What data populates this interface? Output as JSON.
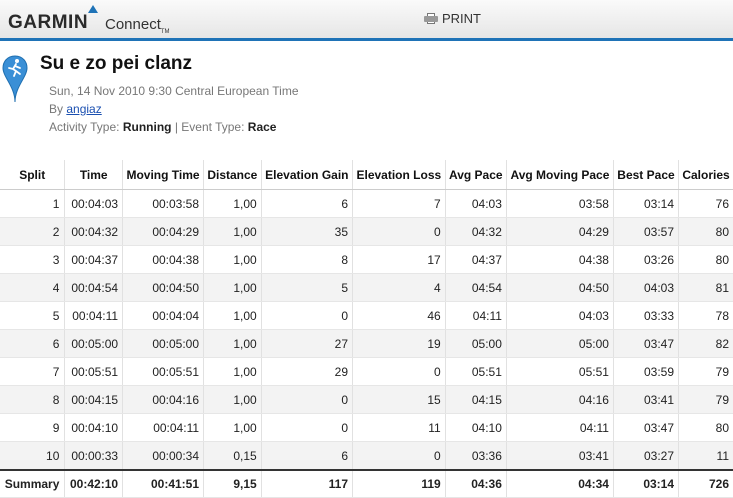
{
  "header": {
    "logo": "GARMIN",
    "logo_sub": "Connect",
    "logo_tm": "TM",
    "print_label": "PRINT"
  },
  "activity": {
    "title": "Su e zo pei clanz",
    "datetime": "Sun, 14 Nov 2010 9:30 Central European Time",
    "by_prefix": "By",
    "author": "angiaz",
    "type_label": "Activity Type:",
    "type_value": "Running",
    "event_label": "| Event Type:",
    "event_value": "Race"
  },
  "table": {
    "columns": [
      "Split",
      "Time",
      "Moving Time",
      "Distance",
      "Elevation Gain",
      "Elevation Loss",
      "Avg Pace",
      "Avg Moving Pace",
      "Best Pace",
      "Calories"
    ],
    "rows": [
      [
        "1",
        "00:04:03",
        "00:03:58",
        "1,00",
        "6",
        "7",
        "04:03",
        "03:58",
        "03:14",
        "76"
      ],
      [
        "2",
        "00:04:32",
        "00:04:29",
        "1,00",
        "35",
        "0",
        "04:32",
        "04:29",
        "03:57",
        "80"
      ],
      [
        "3",
        "00:04:37",
        "00:04:38",
        "1,00",
        "8",
        "17",
        "04:37",
        "04:38",
        "03:26",
        "80"
      ],
      [
        "4",
        "00:04:54",
        "00:04:50",
        "1,00",
        "5",
        "4",
        "04:54",
        "04:50",
        "04:03",
        "81"
      ],
      [
        "5",
        "00:04:11",
        "00:04:04",
        "1,00",
        "0",
        "46",
        "04:11",
        "04:03",
        "03:33",
        "78"
      ],
      [
        "6",
        "00:05:00",
        "00:05:00",
        "1,00",
        "27",
        "19",
        "05:00",
        "05:00",
        "03:47",
        "82"
      ],
      [
        "7",
        "00:05:51",
        "00:05:51",
        "1,00",
        "29",
        "0",
        "05:51",
        "05:51",
        "03:59",
        "79"
      ],
      [
        "8",
        "00:04:15",
        "00:04:16",
        "1,00",
        "0",
        "15",
        "04:15",
        "04:16",
        "03:41",
        "79"
      ],
      [
        "9",
        "00:04:10",
        "00:04:11",
        "1,00",
        "0",
        "11",
        "04:10",
        "04:11",
        "03:47",
        "80"
      ],
      [
        "10",
        "00:00:33",
        "00:00:34",
        "0,15",
        "6",
        "0",
        "03:36",
        "03:41",
        "03:27",
        "11"
      ]
    ],
    "summary": [
      "Summary",
      "00:42:10",
      "00:41:51",
      "9,15",
      "117",
      "119",
      "04:36",
      "04:34",
      "03:14",
      "726"
    ]
  }
}
